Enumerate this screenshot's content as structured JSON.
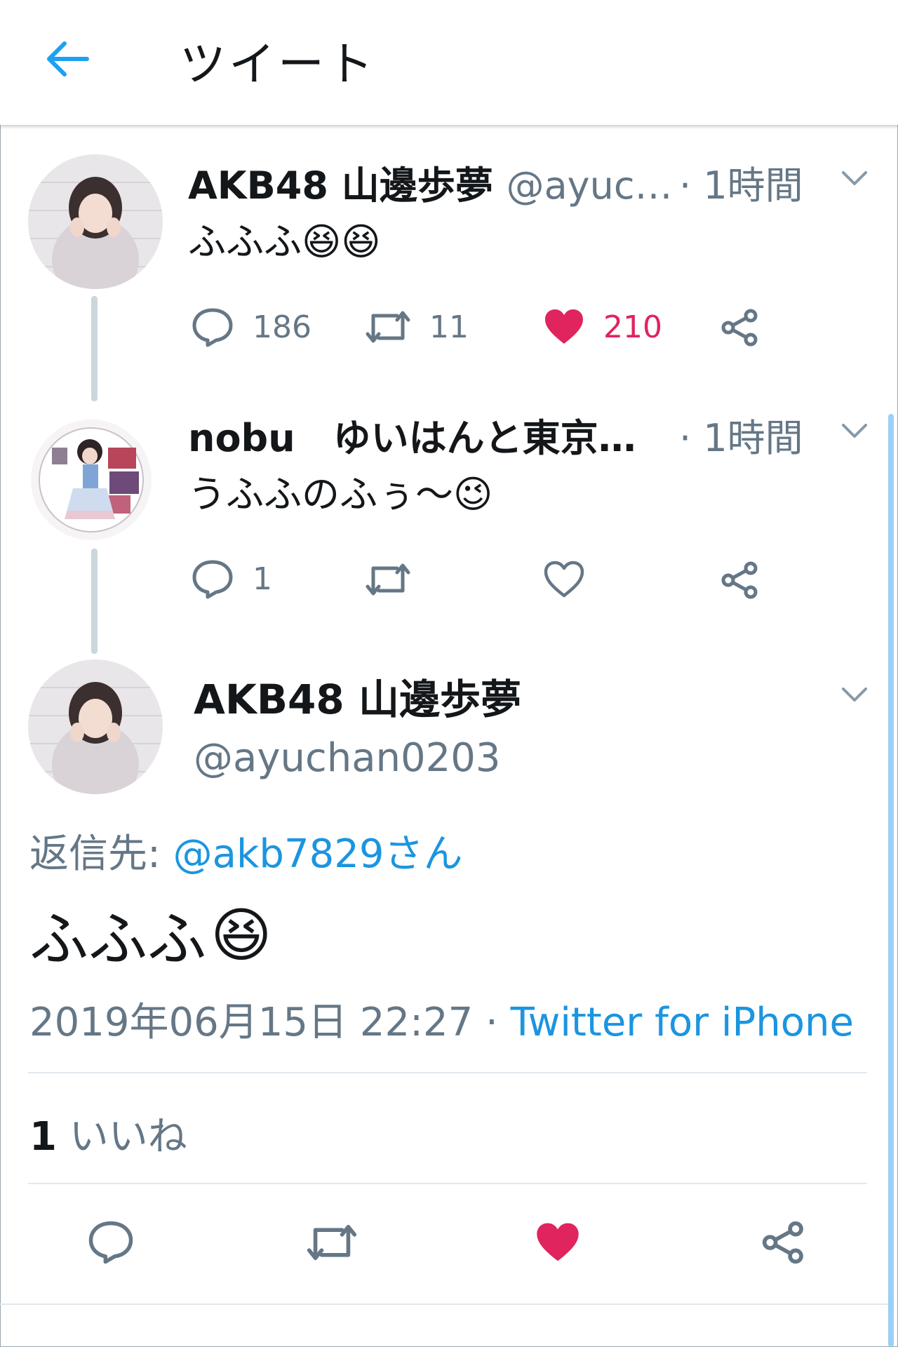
{
  "header": {
    "title": "ツイート"
  },
  "tweets": [
    {
      "name": "AKB48 山邊歩夢",
      "handle": "@ayuc…",
      "time": "· 1時間",
      "text": "ふふふ😆😆",
      "actions": {
        "reply_count": "186",
        "retweet_count": "11",
        "like_count": "210",
        "liked": true
      }
    },
    {
      "name": "nobu　ゆいはんと東京…",
      "time": "· 1時間",
      "text": "うふふのふぅ〜😉",
      "actions": {
        "reply_count": "1",
        "retweet_count": "",
        "like_count": "",
        "liked": false
      }
    }
  ],
  "focused_tweet": {
    "name": "AKB48 山邊歩夢",
    "handle": "@ayuchan0203",
    "reply_prefix": "返信先: ",
    "reply_mention": "@akb7829さん",
    "text": "ふふふ",
    "emoji": "😆",
    "timestamp": "2019年06月15日 22:27 · ",
    "source": "Twitter for iPhone",
    "like_count": "1",
    "like_label": " いいね",
    "liked": true
  },
  "colors": {
    "accent": "#1da1f2",
    "like": "#e0245e",
    "secondary_text": "#657786"
  }
}
